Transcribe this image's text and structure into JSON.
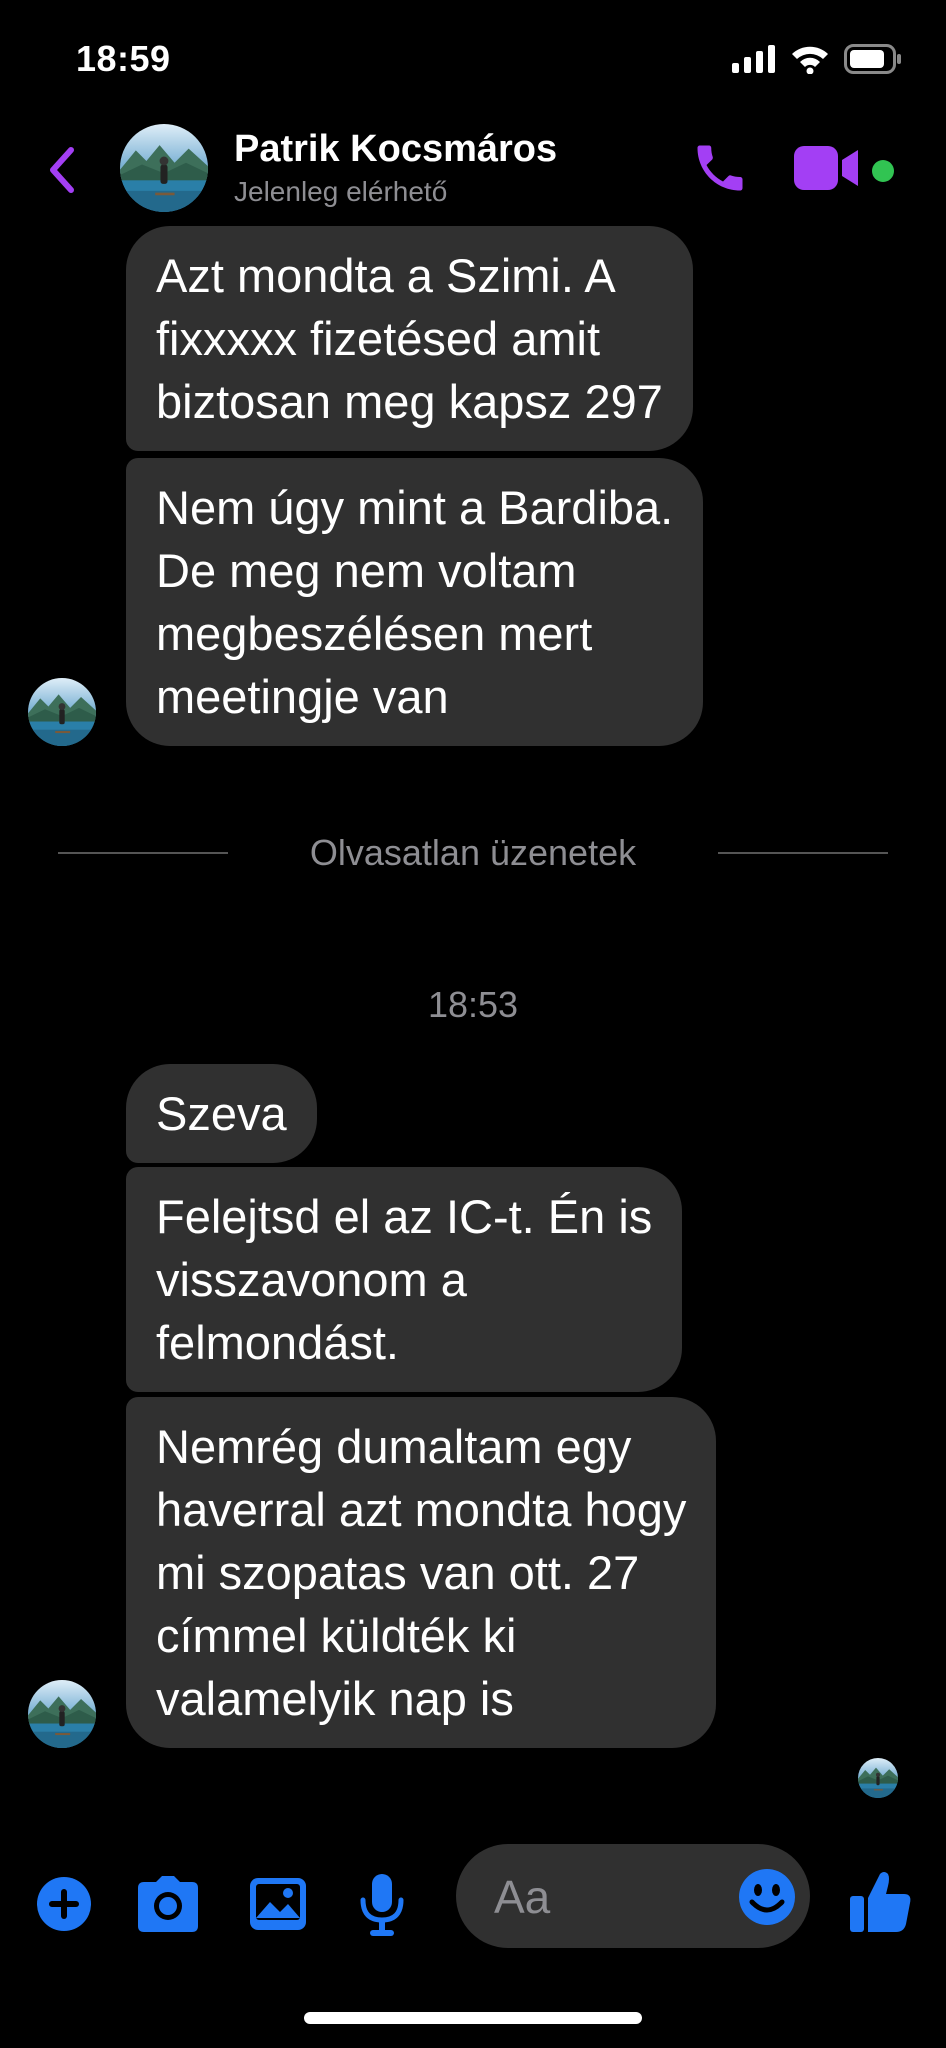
{
  "status_bar": {
    "time": "18:59"
  },
  "header": {
    "contact_name": "Patrik Kocsmáros",
    "contact_status": "Jelenleg elérhető",
    "accent_color": "#a33ff4",
    "online_color": "#31c452"
  },
  "messages_before": [
    {
      "lines": [
        "Azt mondta a Szimi. A",
        "fixxxxx fizetésed amit",
        "biztosan meg kapsz 297"
      ]
    },
    {
      "lines": [
        "Nem úgy mint a Bardiba.",
        "De meg nem voltam",
        "megbeszélésen mert",
        "meetingje van"
      ]
    }
  ],
  "unread_divider": "Olvasatlan üzenetek",
  "timestamp": "18:53",
  "messages_after": [
    {
      "lines": [
        "Szeva"
      ]
    },
    {
      "lines": [
        "Felejtsd el az IC-t. Én is",
        "visszavonom a",
        "felmondást."
      ]
    },
    {
      "lines": [
        "Nemrég dumaltam egy",
        "haverral azt mondta hogy",
        "mi szopatas van ott. 27",
        "címmel küldték ki",
        "valamelyik nap is"
      ]
    }
  ],
  "composer": {
    "placeholder": "Aa",
    "icon_color": "#1f77f5",
    "icons": [
      "plus-icon",
      "camera-icon",
      "gallery-icon",
      "microphone-icon",
      "emoji-icon",
      "thumbs-up-icon"
    ]
  }
}
